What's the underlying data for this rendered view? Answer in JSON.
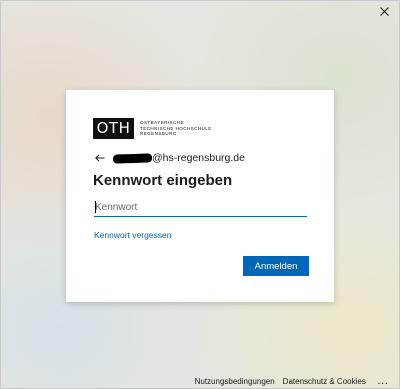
{
  "window": {
    "close_symbol": "✕"
  },
  "logo": {
    "mark": "OTH",
    "lines": [
      "OSTBAYERISCHE",
      "TECHNISCHE HOCHSCHULE",
      "REGENSBURG"
    ]
  },
  "identity": {
    "email_domain": "@hs-regensburg.de"
  },
  "login": {
    "heading": "Kennwort eingeben",
    "password_placeholder": "Kennwort",
    "password_value": "",
    "forgot_link": "Kennwort vergessen",
    "signin_button": "Anmelden"
  },
  "footer": {
    "terms": "Nutzungsbedingungen",
    "privacy": "Datenschutz & Cookies",
    "more": "..."
  },
  "colors": {
    "accent": "#0067b8",
    "card_background": "#ffffff",
    "logo_background": "#111111"
  },
  "icons": {
    "close": "close-icon",
    "back": "back-arrow-icon"
  }
}
